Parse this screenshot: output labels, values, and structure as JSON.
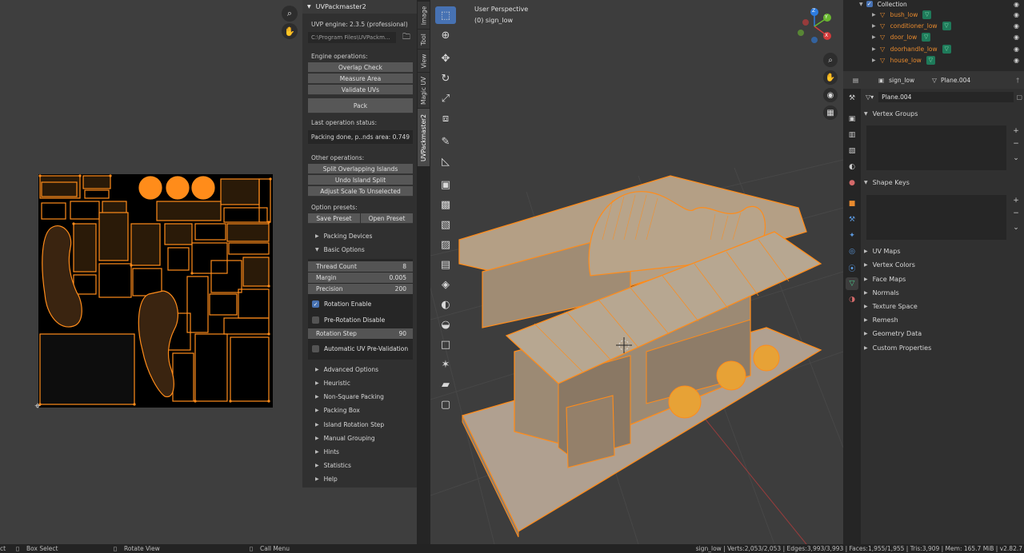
{
  "uv_editor": {
    "nav_icons": [
      "zoom-icon",
      "hand-pan-icon"
    ]
  },
  "npanel": {
    "title": "UVPackmaster2",
    "engine": "UVP engine: 2.3.5 (professional)",
    "path": "C:\\Program Files\\UVPackm...",
    "engine_ops_label": "Engine operations:",
    "engine_ops": [
      "Overlap Check",
      "Measure Area",
      "Validate UVs"
    ],
    "pack": "Pack",
    "last_status_label": "Last operation status:",
    "last_status": "Packing done, p..nds area: 0.749",
    "other_ops_label": "Other operations:",
    "other_ops": [
      "Split Overlapping Islands",
      "Undo Island Split",
      "Adjust Scale To Unselected"
    ],
    "presets_label": "Option presets:",
    "save_preset": "Save Preset",
    "open_preset": "Open Preset",
    "packing_devices": "Packing Devices",
    "basic_options": "Basic Options",
    "thread_count_label": "Thread Count",
    "thread_count": "8",
    "margin_label": "Margin",
    "margin": "0.005",
    "precision_label": "Precision",
    "precision": "200",
    "rotation_enable": "Rotation Enable",
    "pre_rotation_disable": "Pre-Rotation Disable",
    "rotation_step_label": "Rotation Step",
    "rotation_step": "90",
    "auto_validation": "Automatic UV Pre-Validation",
    "sections": [
      "Advanced Options",
      "Heuristic",
      "Non-Square Packing",
      "Packing Box",
      "Island Rotation Step",
      "Manual Grouping",
      "Hints",
      "Statistics",
      "Help"
    ]
  },
  "vtabs": [
    "Image",
    "Tool",
    "View",
    "Magic UV",
    "UVPackmaster2"
  ],
  "viewport": {
    "perspective": "User Perspective",
    "object": "(0) sign_low",
    "gizmo_axes": [
      "X",
      "Y",
      "Z"
    ]
  },
  "outliner": {
    "collection": "Collection",
    "items": [
      "bush_low",
      "conditioner_low",
      "door_low",
      "doorhandle_low",
      "house_low"
    ]
  },
  "properties": {
    "object_name": "sign_low",
    "mesh_name": "Plane.004",
    "data_name": "Plane.004",
    "vertex_groups": "Vertex Groups",
    "shape_keys": "Shape Keys",
    "sections": [
      "UV Maps",
      "Vertex Colors",
      "Face Maps",
      "Normals",
      "Texture Space",
      "Remesh",
      "Geometry Data",
      "Custom Properties"
    ]
  },
  "statusbar": {
    "select": "ct",
    "box_select": "Box Select",
    "rotate_view": "Rotate View",
    "call_menu": "Call Menu",
    "stats": "sign_low | Verts:2,053/2,053 | Edges:3,993/3,993 | Faces:1,955/1,955 | Tris:3,909 | Mem: 165.7 MiB | v2.82.7"
  },
  "colors": {
    "accent": "#4772b3",
    "selection_orange": "#ff8c1a",
    "object_orange": "#e88a2e"
  }
}
